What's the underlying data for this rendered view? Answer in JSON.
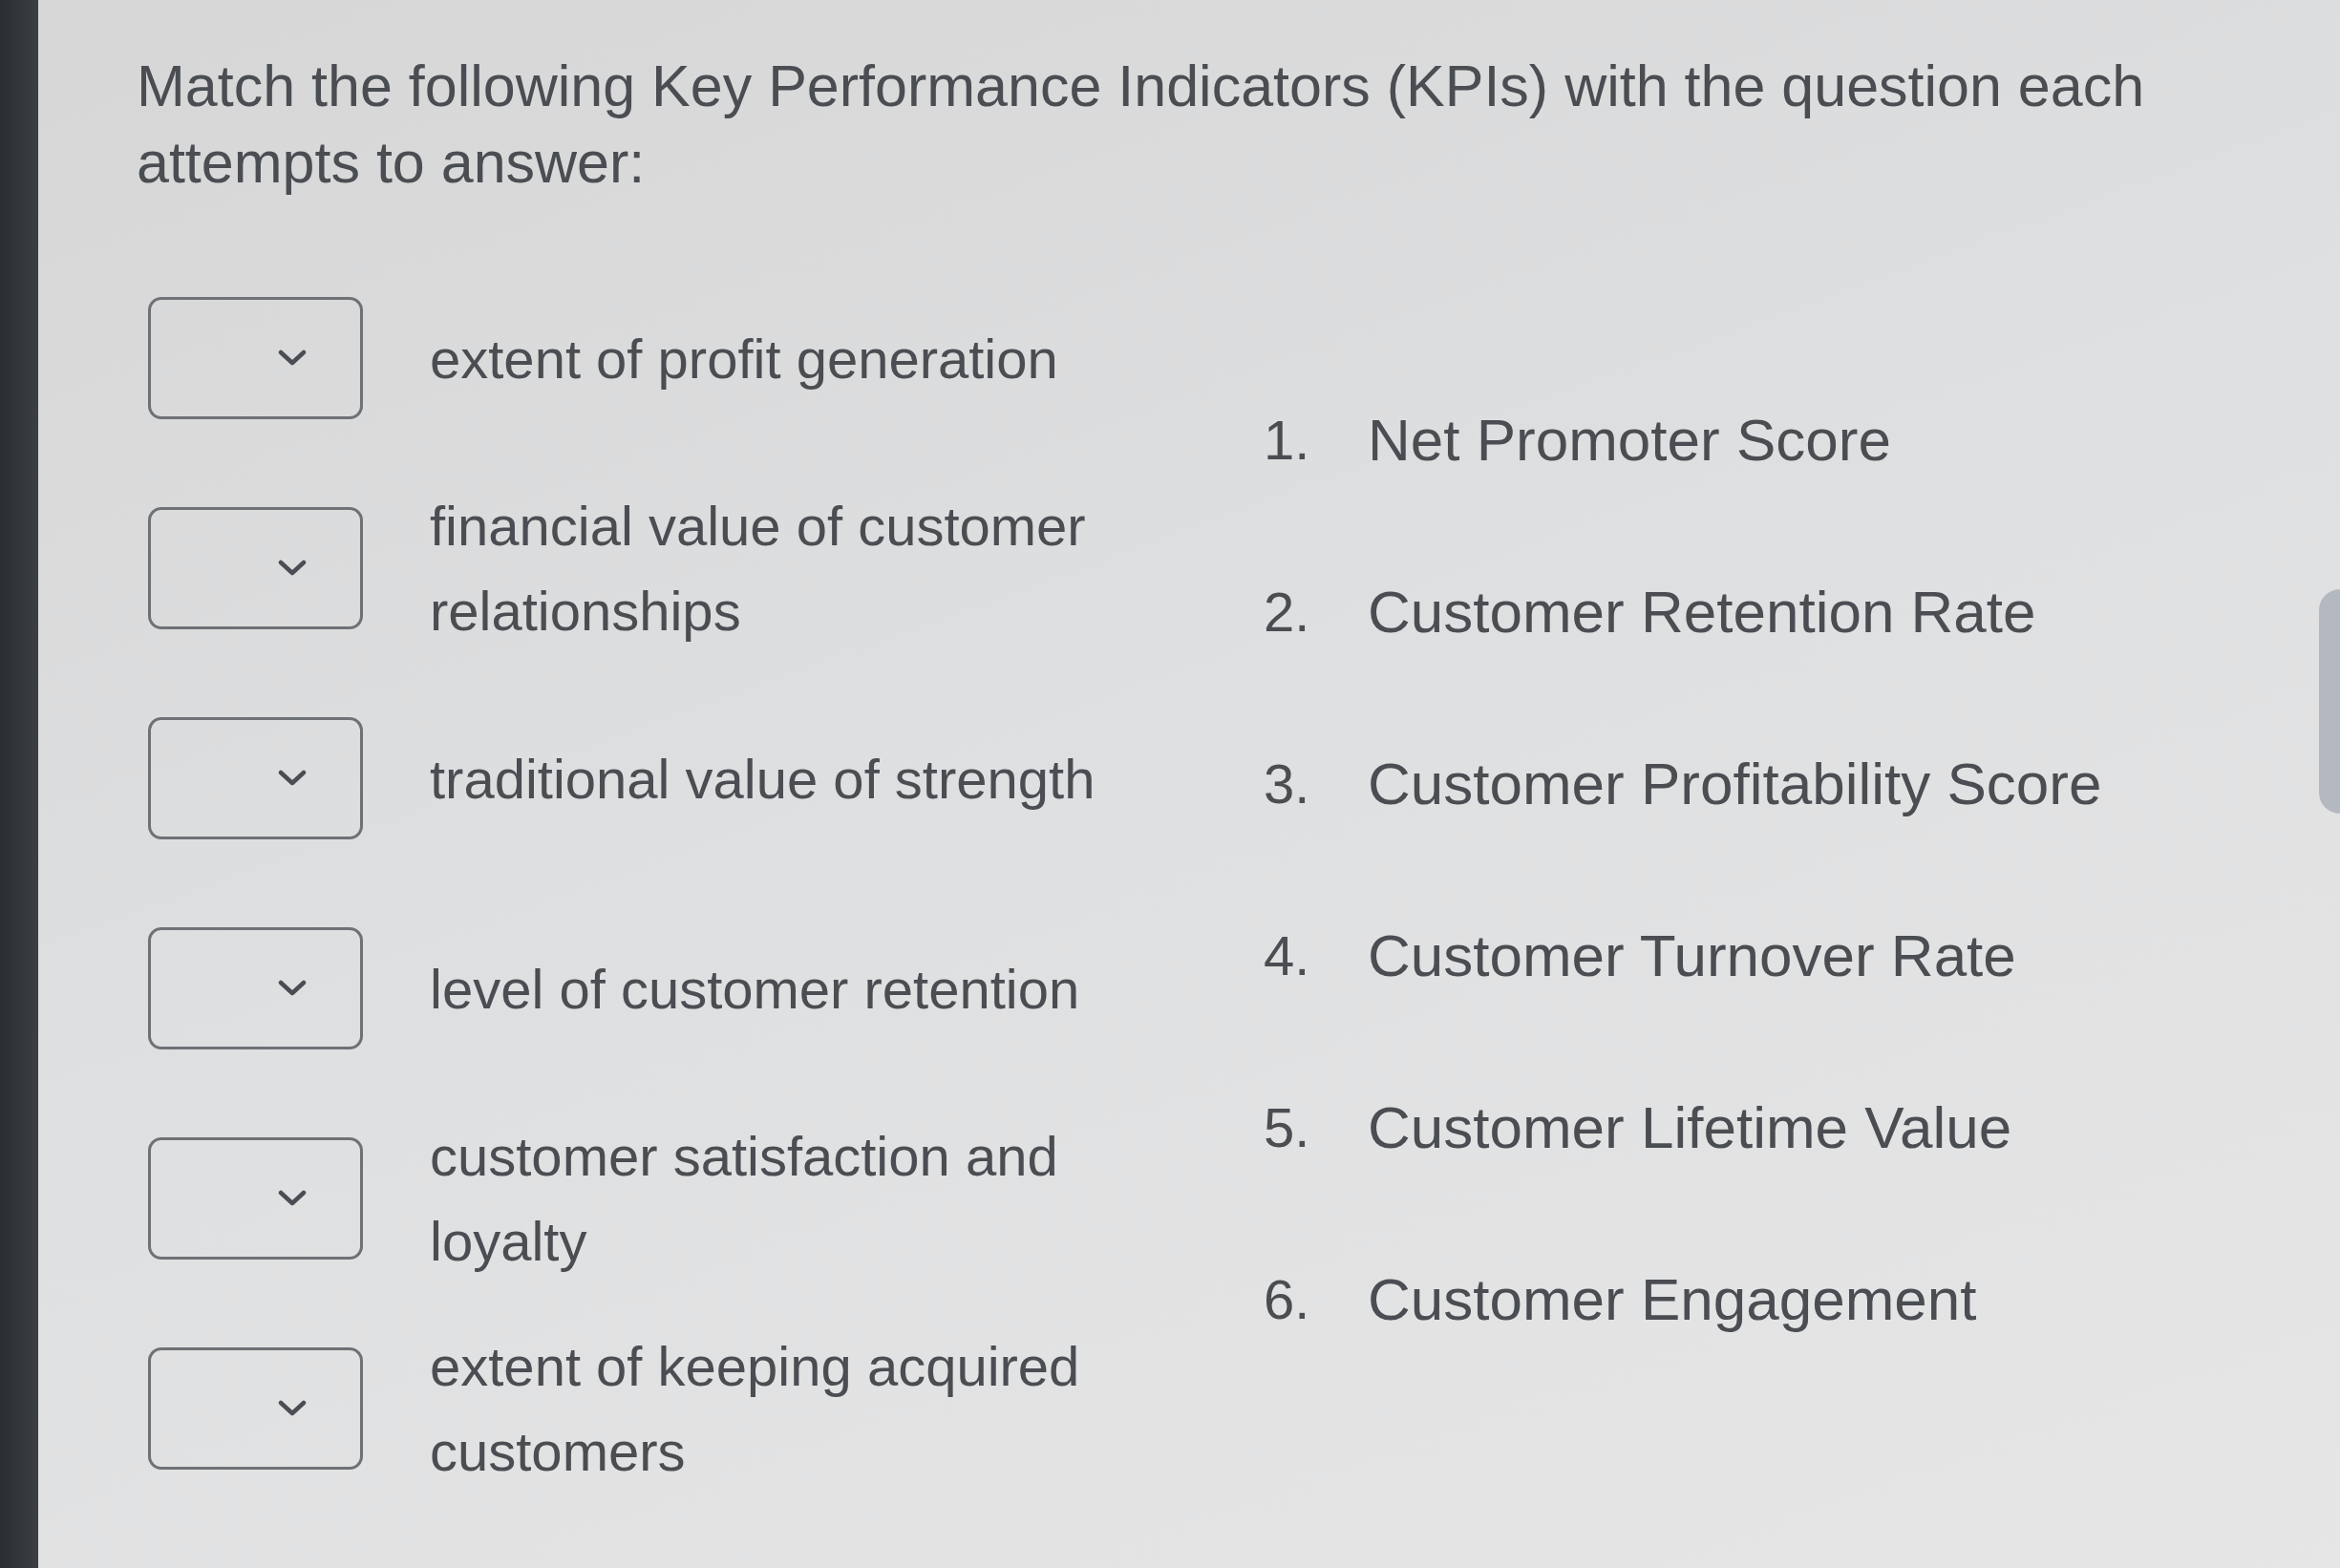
{
  "prompt": {
    "text": "Match the following Key Performance Indicators (KPIs) with the question each attempts to answer:"
  },
  "questions": [
    {
      "text": "extent of profit generation"
    },
    {
      "text": "financial value of customer relationships"
    },
    {
      "text": "traditional value of strength"
    },
    {
      "text": "level of customer retention"
    },
    {
      "text": "customer satisfaction and loyalty"
    },
    {
      "text": "extent of keeping acquired customers"
    }
  ],
  "options": [
    {
      "number": "1.",
      "label": "Net Promoter Score"
    },
    {
      "number": "2.",
      "label": "Customer Retention Rate"
    },
    {
      "number": "3.",
      "label": "Customer Profitability Score"
    },
    {
      "number": "4.",
      "label": "Customer Turnover Rate"
    },
    {
      "number": "5.",
      "label": "Customer Lifetime Value"
    },
    {
      "number": "6.",
      "label": "Customer Engagement"
    }
  ]
}
